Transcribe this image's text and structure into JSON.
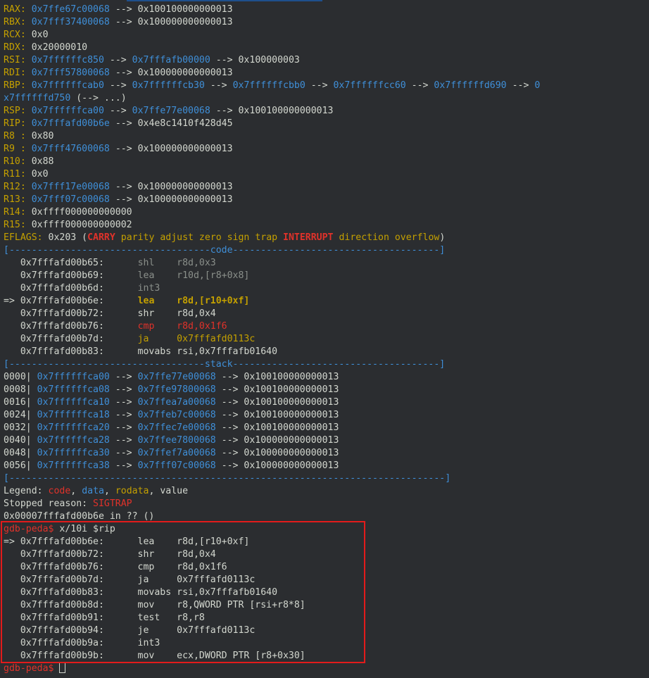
{
  "colors": {
    "label": "#c4a000",
    "pointer": "#3f8fd8",
    "red": "#e0322a",
    "bg": "#2b2d30",
    "text": "#d3d7cf",
    "highlight": "#e21b1b"
  },
  "registers": [
    [
      {
        "t": "RAX:",
        "c": "y"
      },
      {
        "t": " "
      },
      {
        "t": "0x7ffe67c00068",
        "c": "b"
      },
      {
        "t": " --> 0x100100000000013"
      }
    ],
    [
      {
        "t": "RBX:",
        "c": "y"
      },
      {
        "t": " "
      },
      {
        "t": "0x7fff37400068",
        "c": "b"
      },
      {
        "t": " --> 0x100000000000013"
      }
    ],
    [
      {
        "t": "RCX:",
        "c": "y"
      },
      {
        "t": " 0x0"
      }
    ],
    [
      {
        "t": "RDX:",
        "c": "y"
      },
      {
        "t": " 0x20000010"
      }
    ],
    [
      {
        "t": "RSI:",
        "c": "y"
      },
      {
        "t": " "
      },
      {
        "t": "0x7ffffffc850",
        "c": "b"
      },
      {
        "t": " --> "
      },
      {
        "t": "0x7fffafb00000",
        "c": "b"
      },
      {
        "t": " --> 0x100000003"
      }
    ],
    [
      {
        "t": "RDI:",
        "c": "y"
      },
      {
        "t": " "
      },
      {
        "t": "0x7fff57800068",
        "c": "b"
      },
      {
        "t": " --> 0x100000000000013"
      }
    ],
    [
      {
        "t": "RBP:",
        "c": "y"
      },
      {
        "t": " "
      },
      {
        "t": "0x7ffffffcab0",
        "c": "b"
      },
      {
        "t": " --> "
      },
      {
        "t": "0x7ffffffcb30",
        "c": "b"
      },
      {
        "t": " --> "
      },
      {
        "t": "0x7ffffffcbb0",
        "c": "b"
      },
      {
        "t": " --> "
      },
      {
        "t": "0x7ffffffcc60",
        "c": "b"
      },
      {
        "t": " --> "
      },
      {
        "t": "0x7ffffffd690",
        "c": "b"
      },
      {
        "t": " --> "
      },
      {
        "t": "0",
        "c": "b"
      }
    ],
    [
      {
        "t": "x7ffffffd750",
        "c": "b"
      },
      {
        "t": " (--> ...)"
      }
    ],
    [
      {
        "t": "RSP:",
        "c": "y"
      },
      {
        "t": " "
      },
      {
        "t": "0x7ffffffca00",
        "c": "b"
      },
      {
        "t": " --> "
      },
      {
        "t": "0x7ffe77e00068",
        "c": "b"
      },
      {
        "t": " --> 0x100100000000013"
      }
    ],
    [
      {
        "t": "RIP:",
        "c": "y"
      },
      {
        "t": " "
      },
      {
        "t": "0x7fffafd00b6e",
        "c": "b"
      },
      {
        "t": " --> 0x4e8c1410f428d45"
      }
    ],
    [
      {
        "t": "R8 :",
        "c": "y"
      },
      {
        "t": " 0x80"
      }
    ],
    [
      {
        "t": "R9 :",
        "c": "y"
      },
      {
        "t": " "
      },
      {
        "t": "0x7fff47600068",
        "c": "b"
      },
      {
        "t": " --> 0x100000000000013"
      }
    ],
    [
      {
        "t": "R10:",
        "c": "y"
      },
      {
        "t": " 0x88"
      }
    ],
    [
      {
        "t": "R11:",
        "c": "y"
      },
      {
        "t": " 0x0"
      }
    ],
    [
      {
        "t": "R12:",
        "c": "y"
      },
      {
        "t": " "
      },
      {
        "t": "0x7fff17e00068",
        "c": "b"
      },
      {
        "t": " --> 0x100000000000013"
      }
    ],
    [
      {
        "t": "R13:",
        "c": "y"
      },
      {
        "t": " "
      },
      {
        "t": "0x7fff07c00068",
        "c": "b"
      },
      {
        "t": " --> 0x100000000000013"
      }
    ],
    [
      {
        "t": "R14:",
        "c": "y"
      },
      {
        "t": " 0xffff000000000000"
      }
    ],
    [
      {
        "t": "R15:",
        "c": "y"
      },
      {
        "t": " 0xffff000000000002"
      }
    ],
    [
      {
        "t": "EFLAGS:",
        "c": "y"
      },
      {
        "t": " 0x203 ("
      },
      {
        "t": "CARRY",
        "c": "r bold"
      },
      {
        "t": " "
      },
      {
        "t": "parity adjust zero sign trap",
        "c": "y"
      },
      {
        "t": " "
      },
      {
        "t": "INTERRUPT",
        "c": "r bold"
      },
      {
        "t": " "
      },
      {
        "t": "direction overflow",
        "c": "y"
      },
      {
        "t": ")"
      }
    ]
  ],
  "code_header": [
    {
      "t": "[------------------------------------",
      "c": "b"
    },
    {
      "t": "code",
      "c": "b"
    },
    {
      "t": "-------------------------------------]",
      "c": "b"
    }
  ],
  "code": [
    [
      {
        "t": "   0x7fffafd00b65:      "
      },
      {
        "t": "shl    r8d,0x3",
        "c": "grey"
      }
    ],
    [
      {
        "t": "   0x7fffafd00b69:      "
      },
      {
        "t": "lea    r10d,[r8+0x8]",
        "c": "grey"
      }
    ],
    [
      {
        "t": "   0x7fffafd00b6d:      "
      },
      {
        "t": "int3",
        "c": "grey"
      }
    ],
    [
      {
        "t": "=> 0x7fffafd00b6e:      "
      },
      {
        "t": "lea    r8d,[r10+0xf]",
        "c": "y bold"
      }
    ],
    [
      {
        "t": "   0x7fffafd00b72:      shr    r8d,0x4"
      }
    ],
    [
      {
        "t": "   0x7fffafd00b76:      "
      },
      {
        "t": "cmp    r8d,0x1f6",
        "c": "r"
      }
    ],
    [
      {
        "t": "   0x7fffafd00b7d:      "
      },
      {
        "t": "ja     0x7fffafd0113c",
        "c": "y"
      }
    ],
    [
      {
        "t": "   0x7fffafd00b83:      movabs rsi,0x7fffafb01640"
      }
    ]
  ],
  "stack_header": [
    {
      "t": "[-----------------------------------",
      "c": "b"
    },
    {
      "t": "stack",
      "c": "b"
    },
    {
      "t": "-------------------------------------]",
      "c": "b"
    }
  ],
  "stack": [
    [
      {
        "t": "0000| "
      },
      {
        "t": "0x7ffffffca00",
        "c": "b"
      },
      {
        "t": " --> "
      },
      {
        "t": "0x7ffe77e00068",
        "c": "b"
      },
      {
        "t": " --> 0x100100000000013"
      }
    ],
    [
      {
        "t": "0008| "
      },
      {
        "t": "0x7ffffffca08",
        "c": "b"
      },
      {
        "t": " --> "
      },
      {
        "t": "0x7ffe97800068",
        "c": "b"
      },
      {
        "t": " --> 0x100100000000013"
      }
    ],
    [
      {
        "t": "0016| "
      },
      {
        "t": "0x7ffffffca10",
        "c": "b"
      },
      {
        "t": " --> "
      },
      {
        "t": "0x7ffea7a00068",
        "c": "b"
      },
      {
        "t": " --> 0x100100000000013"
      }
    ],
    [
      {
        "t": "0024| "
      },
      {
        "t": "0x7ffffffca18",
        "c": "b"
      },
      {
        "t": " --> "
      },
      {
        "t": "0x7ffeb7c00068",
        "c": "b"
      },
      {
        "t": " --> 0x100100000000013"
      }
    ],
    [
      {
        "t": "0032| "
      },
      {
        "t": "0x7ffffffca20",
        "c": "b"
      },
      {
        "t": " --> "
      },
      {
        "t": "0x7ffec7e00068",
        "c": "b"
      },
      {
        "t": " --> 0x100100000000013"
      }
    ],
    [
      {
        "t": "0040| "
      },
      {
        "t": "0x7ffffffca28",
        "c": "b"
      },
      {
        "t": " --> "
      },
      {
        "t": "0x7ffee7800068",
        "c": "b"
      },
      {
        "t": " --> 0x100000000000013"
      }
    ],
    [
      {
        "t": "0048| "
      },
      {
        "t": "0x7ffffffca30",
        "c": "b"
      },
      {
        "t": " --> "
      },
      {
        "t": "0x7ffef7a00068",
        "c": "b"
      },
      {
        "t": " --> 0x100000000000013"
      }
    ],
    [
      {
        "t": "0056| "
      },
      {
        "t": "0x7ffffffca38",
        "c": "b"
      },
      {
        "t": " --> "
      },
      {
        "t": "0x7fff07c00068",
        "c": "b"
      },
      {
        "t": " --> 0x100000000000013"
      }
    ]
  ],
  "footer_rule": [
    {
      "t": "[------------------------------------------------------------------------------]",
      "c": "b"
    }
  ],
  "legend": [
    {
      "t": "Legend: "
    },
    {
      "t": "code",
      "c": "r"
    },
    {
      "t": ", "
    },
    {
      "t": "data",
      "c": "b"
    },
    {
      "t": ", "
    },
    {
      "t": "rodata",
      "c": "y"
    },
    {
      "t": ", value"
    }
  ],
  "stopped": [
    {
      "t": "Stopped reason: "
    },
    {
      "t": "SIGTRAP",
      "c": "r"
    }
  ],
  "location": [
    {
      "t": "0x00007fffafd00b6e in ?? ()"
    }
  ],
  "prompt_cmd": [
    {
      "t": "gdb-peda$",
      "c": "r"
    },
    {
      "t": " x/10i $rip"
    }
  ],
  "disasm": [
    [
      {
        "t": "=> 0x7fffafd00b6e:      lea    r8d,[r10+0xf]"
      }
    ],
    [
      {
        "t": "   0x7fffafd00b72:      shr    r8d,0x4"
      }
    ],
    [
      {
        "t": "   0x7fffafd00b76:      cmp    r8d,0x1f6"
      }
    ],
    [
      {
        "t": "   0x7fffafd00b7d:      ja     0x7fffafd0113c"
      }
    ],
    [
      {
        "t": "   0x7fffafd00b83:      movabs rsi,0x7fffafb01640"
      }
    ],
    [
      {
        "t": "   0x7fffafd00b8d:      mov    r8,QWORD PTR [rsi+r8*8]"
      }
    ],
    [
      {
        "t": "   0x7fffafd00b91:      test   r8,r8"
      }
    ],
    [
      {
        "t": "   0x7fffafd00b94:      je     0x7fffafd0113c"
      }
    ],
    [
      {
        "t": "   0x7fffafd00b9a:      int3"
      }
    ],
    [
      {
        "t": "   0x7fffafd00b9b:      mov    ecx,DWORD PTR [r8+0x30]"
      }
    ]
  ],
  "prompt_final": [
    {
      "t": "gdb-peda$",
      "c": "r"
    },
    {
      "t": " "
    }
  ]
}
